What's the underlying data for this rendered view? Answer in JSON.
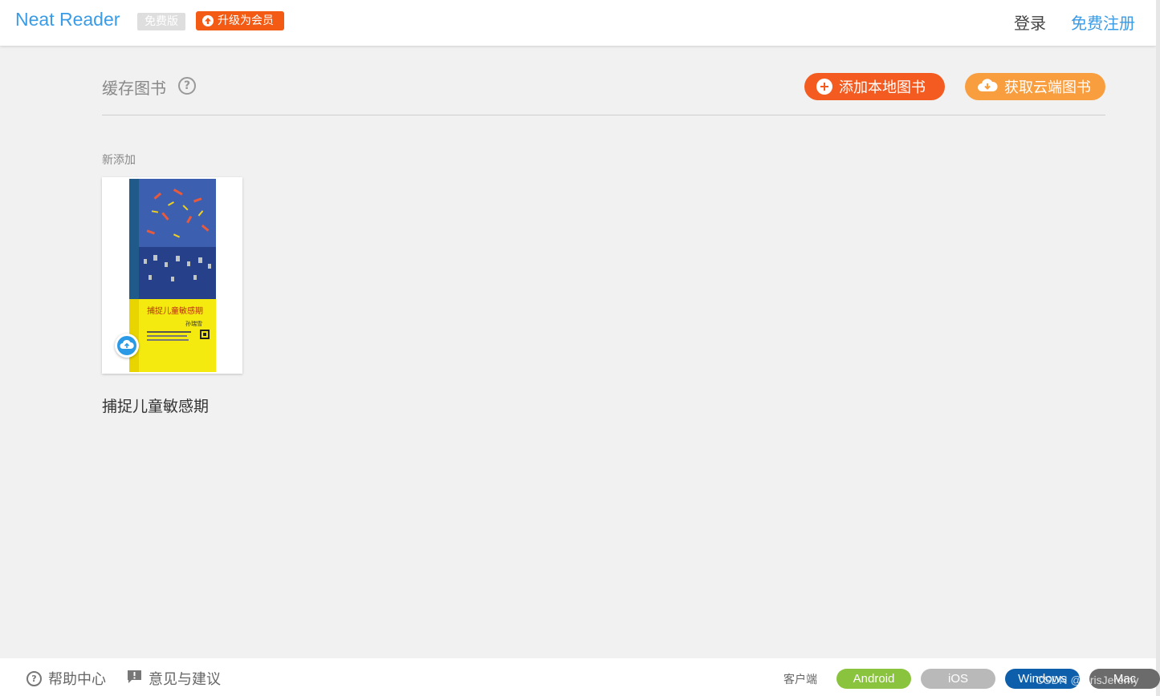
{
  "header": {
    "app_title": "Neat Reader",
    "free_badge": "免费版",
    "upgrade_label": "升级为会员",
    "login_label": "登录",
    "register_label": "免费注册"
  },
  "main": {
    "section_title": "缓存图书",
    "add_local_label": "添加本地图书",
    "get_cloud_label": "获取云端图书",
    "group_label": "新添加",
    "books": [
      {
        "title": "捕捉儿童敏感期",
        "cover_title": "捕捉儿童敏感期",
        "cover_author": "孙瑞雪"
      }
    ]
  },
  "footer": {
    "help_label": "帮助中心",
    "feedback_label": "意见与建议",
    "client_label": "客户端",
    "platforms": [
      "Android",
      "iOS",
      "Windows",
      "Mac"
    ],
    "watermark": "CSDN @CrisJeremy"
  },
  "colors": {
    "brand_blue": "#3a9be6",
    "upgrade_orange": "#f35b14",
    "add_orange": "#f35b21",
    "cloud_orange": "#f99e3f",
    "android_green": "#8ac33d",
    "windows_blue": "#0e5fab"
  },
  "icons": {
    "help": "help-circle-icon",
    "add": "plus-circle-icon",
    "cloud": "cloud-download-icon",
    "upload": "cloud-upload-icon",
    "feedback": "message-icon"
  }
}
